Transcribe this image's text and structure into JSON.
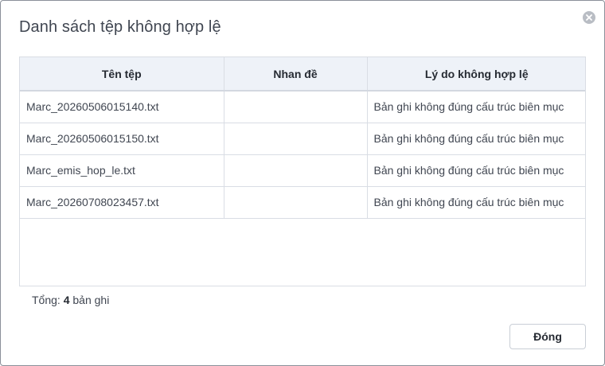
{
  "dialog": {
    "title": "Danh sách tệp không hợp lệ",
    "close_icon": "close-icon"
  },
  "table": {
    "columns": [
      "Tên tệp",
      "Nhan đề",
      "Lý do không hợp lệ"
    ],
    "rows": [
      [
        "Marc_20260506015140.txt",
        "",
        "Bản ghi không đúng cấu trúc biên mục"
      ],
      [
        "Marc_20260506015150.txt",
        "",
        "Bản ghi không đúng cấu trúc biên mục"
      ],
      [
        "Marc_emis_hop_le.txt",
        "",
        "Bản ghi không đúng cấu trúc biên mục"
      ],
      [
        "Marc_20260708023457.txt",
        "",
        "Bản ghi không đúng cấu trúc biên mục"
      ]
    ]
  },
  "footer": {
    "total_prefix": "Tổng:",
    "total_count": "4",
    "total_suffix": "bản ghi",
    "close_button": "Đóng"
  },
  "colors": {
    "header_bg": "#eef2f8",
    "border": "#d9dde4",
    "text": "#404651"
  }
}
